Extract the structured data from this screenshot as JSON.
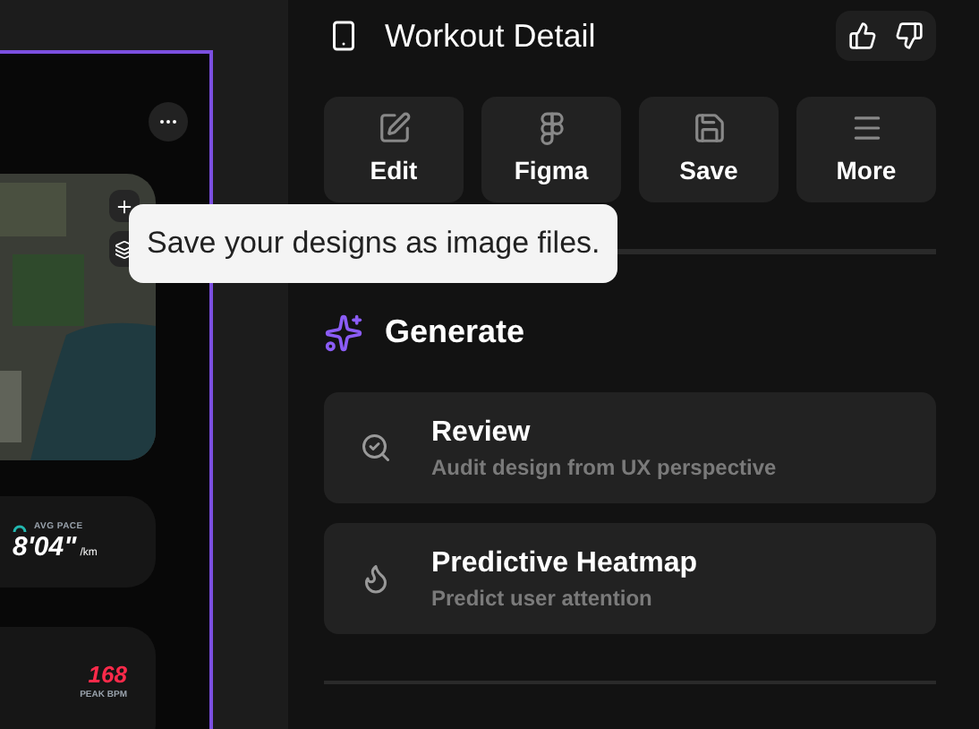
{
  "canvas": {
    "stats": [
      {
        "kind": "pace",
        "label": "AVG PACE",
        "value": "8'04\"",
        "unit": "/km"
      },
      {
        "kind": "peak",
        "label": "PEAK BPM",
        "value": "168"
      }
    ]
  },
  "tooltip": "Save your designs as image files.",
  "panel": {
    "title": "Workout Detail",
    "actions": [
      {
        "label": "Edit"
      },
      {
        "label": "Figma"
      },
      {
        "label": "Save"
      },
      {
        "label": "More"
      }
    ],
    "section": "Generate",
    "tools": [
      {
        "title": "Review",
        "subtitle": "Audit design from UX perspective"
      },
      {
        "title": "Predictive Heatmap",
        "subtitle": "Predict user attention"
      }
    ]
  }
}
